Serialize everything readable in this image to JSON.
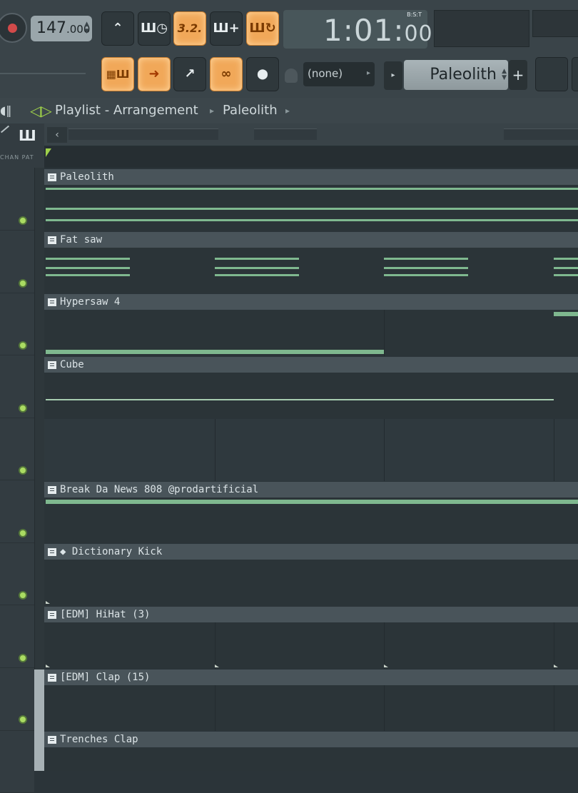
{
  "toolbar": {
    "tempo": "147",
    "tempo_decimals": ".000",
    "time_main": "1:01:",
    "time_sub": "00",
    "time_label": "B:S:T",
    "pattern_select": "(none)",
    "current_pattern": "Paleolith",
    "add_pattern": "+"
  },
  "top_buttons": [
    {
      "name": "typing-keyboard-to-piano-icon",
      "label": "",
      "active": false
    },
    {
      "name": "metronome-wait-icon",
      "label": "Ш◷",
      "active": false
    },
    {
      "name": "countdown-before-recording-button",
      "label": "3.2.",
      "active": true
    },
    {
      "name": "step-edit-icon",
      "label": "Ш+",
      "active": false
    },
    {
      "name": "loop-recording-icon",
      "label": "Ш↻",
      "active": true
    }
  ],
  "row2_buttons": [
    {
      "name": "blend-recording-icon",
      "label": "▦Ш",
      "active": true
    },
    {
      "name": "snap-arrow-icon",
      "label": "➜",
      "active": true
    },
    {
      "name": "link-icon",
      "label": "↗",
      "active": false
    },
    {
      "name": "chain-link-icon",
      "label": "∞",
      "active": true
    },
    {
      "name": "hat-icon",
      "label": "⬤",
      "active": false
    }
  ],
  "playlist": {
    "title": "Playlist - Arrangement",
    "breadcrumb": "Paleolith",
    "separator": "▸"
  },
  "left_labels": "CHAN PAT",
  "tracks": [
    {
      "label": "Paleolith"
    },
    {
      "label": "Fat saw"
    },
    {
      "label": "Hypersaw 4"
    },
    {
      "label": "Cube"
    },
    {
      "label": ""
    },
    {
      "label": "Break Da News 808 @prodartificial"
    },
    {
      "label": "◆ Dictionary Kick"
    },
    {
      "label": "[EDM] HiHat (3)"
    },
    {
      "label": "[EDM] Clap (15)"
    },
    {
      "label": "Trenches Clap"
    }
  ],
  "colors": {
    "accent_orange": "#f1a859",
    "note_green": "#7fb88f",
    "led_green": "#aadb62",
    "record_red": "#d24a4a"
  }
}
